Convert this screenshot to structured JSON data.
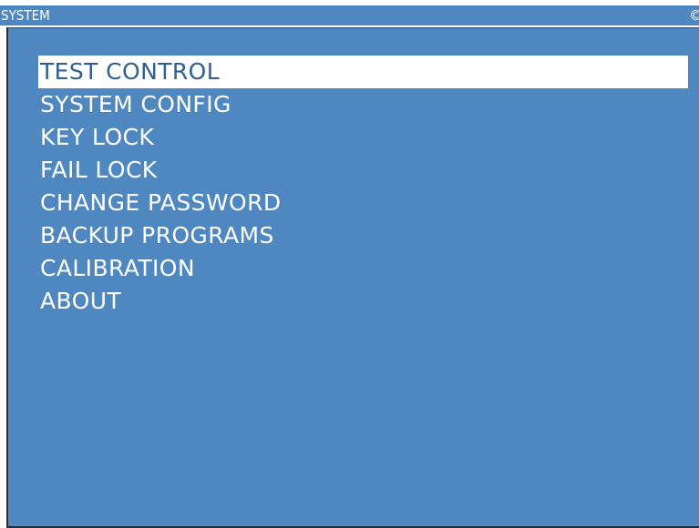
{
  "window": {
    "title": "SYSTEM",
    "corner_glyph": "©"
  },
  "menu": {
    "selected_index": 0,
    "items": [
      {
        "label": "TEST CONTROL"
      },
      {
        "label": "SYSTEM CONFIG"
      },
      {
        "label": "KEY LOCK"
      },
      {
        "label": "FAIL LOCK"
      },
      {
        "label": "CHANGE PASSWORD"
      },
      {
        "label": "BACKUP PROGRAMS"
      },
      {
        "label": "CALIBRATION"
      },
      {
        "label": "ABOUT"
      }
    ]
  },
  "colors": {
    "background": "#4f88c0",
    "text": "#ffffff",
    "highlight_background": "#ffffff",
    "highlight_text": "#2f5f94"
  }
}
